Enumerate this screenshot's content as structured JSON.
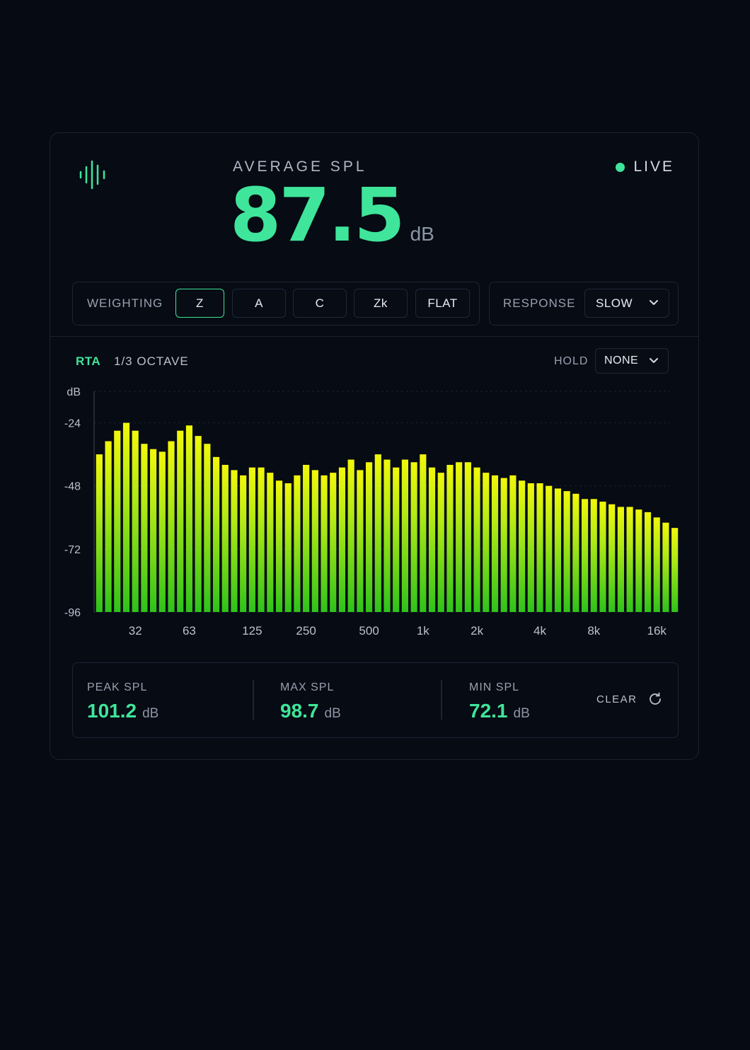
{
  "header": {
    "icon": "waveform-icon",
    "avg_label": "AVERAGE SPL",
    "avg_value": "87.5",
    "avg_unit": "dB",
    "live_label": "LIVE",
    "accent": "#3fe59a"
  },
  "controls": {
    "weighting_label": "WEIGHTING",
    "weighting_options": [
      "Z",
      "A",
      "C",
      "Zk",
      "FLAT"
    ],
    "weighting_selected": "Z",
    "response_label": "RESPONSE",
    "response_value": "SLOW"
  },
  "rta": {
    "title": "RTA",
    "subtitle": "1/3 OCTAVE",
    "hold_label": "HOLD",
    "hold_value": "NONE"
  },
  "chart_data": {
    "type": "bar",
    "ylabel": "dB",
    "ylim": [
      -96,
      -12
    ],
    "yticks": [
      -24,
      -48,
      -72,
      -96
    ],
    "xtick_labels": [
      "32",
      "63",
      "125",
      "250",
      "500",
      "1k",
      "2k",
      "4k",
      "8k",
      "16k"
    ],
    "xtick_bar_index": [
      4,
      10,
      17,
      23,
      30,
      36,
      42,
      49,
      55,
      62
    ],
    "grid": true,
    "colors": [
      "#f2f70a",
      "#9ae61c",
      "#2fc21b"
    ],
    "values": [
      -36,
      -31,
      -27,
      -24,
      -27,
      -32,
      -34,
      -35,
      -31,
      -27,
      -25,
      -29,
      -32,
      -37,
      -40,
      -42,
      -44,
      -41,
      -41,
      -43,
      -46,
      -47,
      -44,
      -40,
      -42,
      -44,
      -43,
      -41,
      -38,
      -42,
      -39,
      -36,
      -38,
      -41,
      -38,
      -39,
      -36,
      -41,
      -43,
      -40,
      -39,
      -39,
      -41,
      -43,
      -44,
      -45,
      -44,
      -46,
      -47,
      -47,
      -48,
      -49,
      -50,
      -51,
      -53,
      -53,
      -54,
      -55,
      -56,
      -56,
      -57,
      -58,
      -60,
      -62,
      -64
    ]
  },
  "stats": {
    "peak_label": "PEAK SPL",
    "peak_value": "101.2",
    "peak_unit": "dB",
    "max_label": "MAX SPL",
    "max_value": "98.7",
    "max_unit": "dB",
    "min_label": "MIN SPL",
    "min_value": "72.1",
    "min_unit": "dB",
    "clear_label": "CLEAR"
  }
}
